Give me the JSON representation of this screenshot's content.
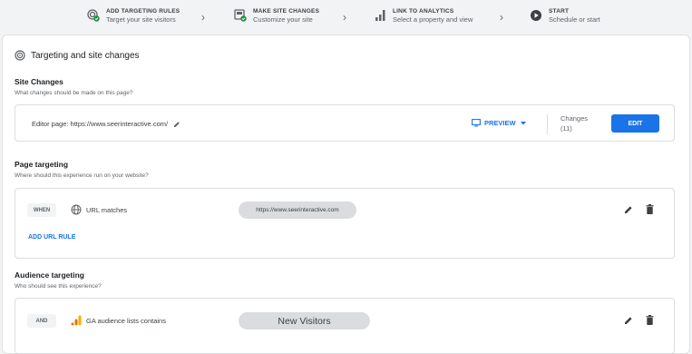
{
  "stepper": {
    "steps": [
      {
        "title": "ADD TARGETING RULES",
        "subtitle": "Target your site visitors",
        "icon": "target-check-icon"
      },
      {
        "title": "MAKE SITE CHANGES",
        "subtitle": "Customize your site",
        "icon": "page-check-icon"
      },
      {
        "title": "LINK TO ANALYTICS",
        "subtitle": "Select a property and view",
        "icon": "analytics-bars-icon"
      },
      {
        "title": "START",
        "subtitle": "Schedule or start",
        "icon": "play-circle-icon"
      }
    ]
  },
  "header": {
    "title": "Targeting and site changes"
  },
  "site_changes": {
    "title": "Site Changes",
    "subtitle": "What changes should be made on this page?",
    "editor_page": "Editor page: https://www.seerinteractive.com/",
    "preview_label": "PREVIEW",
    "changes_label": "Changes",
    "changes_count": "(11)",
    "edit_label": "EDIT"
  },
  "page_targeting": {
    "title": "Page targeting",
    "subtitle": "Where should this experience run on your website?",
    "when_label": "WHEN",
    "rule_label": "URL matches",
    "rule_value": "https://www.seerinteractive.com",
    "add_rule_label": "ADD URL RULE"
  },
  "audience_targeting": {
    "title": "Audience targeting",
    "subtitle": "Who should see this experience?",
    "and_label": "AND",
    "rule_label": "GA audience lists contains",
    "rule_value": "New Visitors"
  },
  "colors": {
    "accent": "#1a73e8",
    "success": "#1e8e3e",
    "analytics_orange": "#f9ab00"
  }
}
